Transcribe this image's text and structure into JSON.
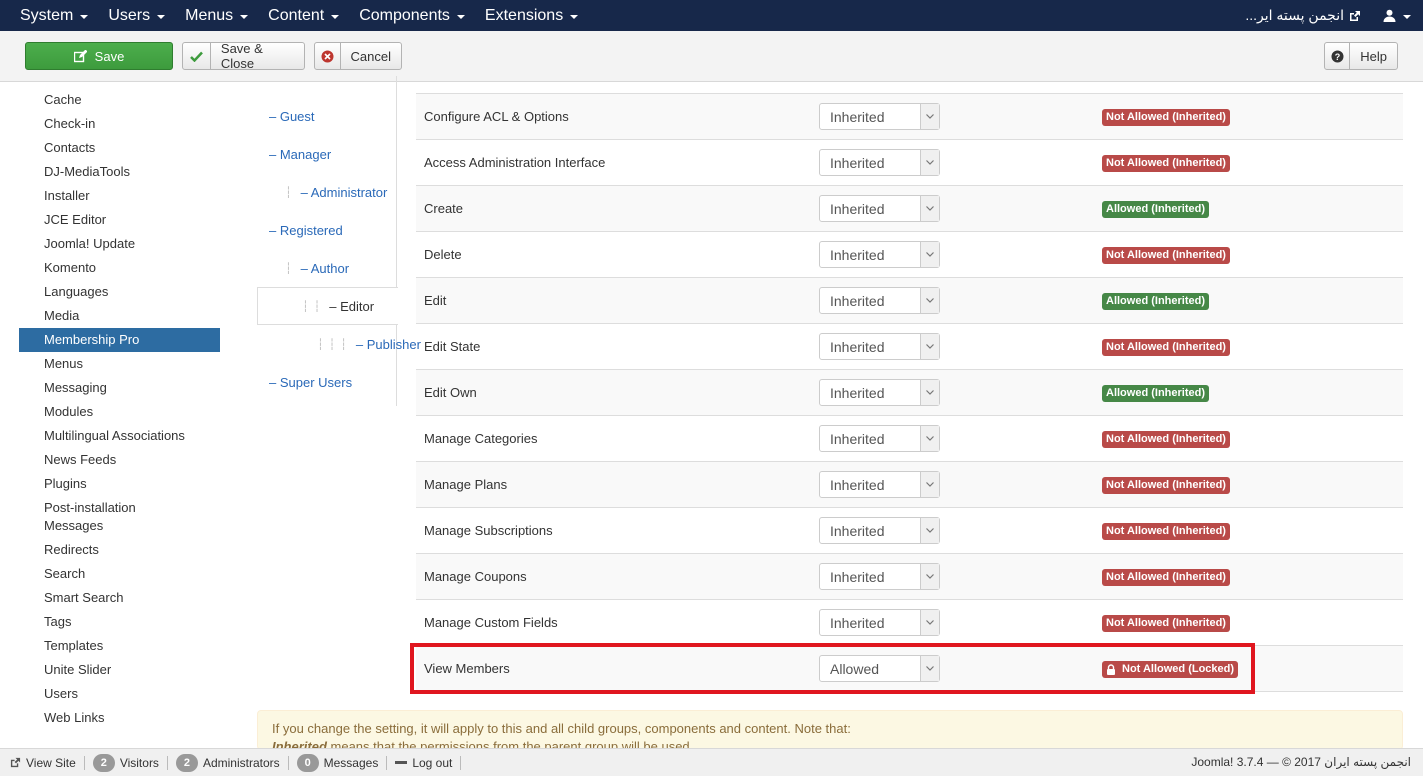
{
  "navbar": {
    "menu": [
      "System",
      "Users",
      "Menus",
      "Content",
      "Components",
      "Extensions"
    ],
    "site_name": "...انجمن پسته ایر"
  },
  "toolbar": {
    "save": "Save",
    "save_close": "Save & Close",
    "cancel": "Cancel",
    "help": "Help"
  },
  "sidebar": {
    "items": [
      "Cache",
      "Check-in",
      "Contacts",
      "DJ-MediaTools",
      "Installer",
      "JCE Editor",
      "Joomla! Update",
      "Komento",
      "Languages",
      "Media",
      "Membership Pro",
      "Menus",
      "Messaging",
      "Modules",
      "Multilingual Associations",
      "News Feeds",
      "Plugins",
      "Post-installation Messages",
      "Redirects",
      "Search",
      "Smart Search",
      "Tags",
      "Templates",
      "Unite Slider",
      "Users",
      "Web Links"
    ],
    "active": "Membership Pro"
  },
  "groups": [
    {
      "label": "– Guest",
      "depth": 0
    },
    {
      "label": "– Manager",
      "depth": 0
    },
    {
      "label": "– Administrator",
      "depth": 1
    },
    {
      "label": "– Registered",
      "depth": 0
    },
    {
      "label": "– Author",
      "depth": 1
    },
    {
      "label": "– Editor",
      "depth": 2
    },
    {
      "label": "– Publisher",
      "depth": 3
    },
    {
      "label": "– Super Users",
      "depth": 0
    }
  ],
  "active_group": "– Editor",
  "permissions": [
    {
      "action": "Configure ACL & Options",
      "setting": "Inherited",
      "calculated": "Not Allowed (Inherited)",
      "status": "denied"
    },
    {
      "action": "Access Administration Interface",
      "setting": "Inherited",
      "calculated": "Not Allowed (Inherited)",
      "status": "denied"
    },
    {
      "action": "Create",
      "setting": "Inherited",
      "calculated": "Allowed (Inherited)",
      "status": "allowed"
    },
    {
      "action": "Delete",
      "setting": "Inherited",
      "calculated": "Not Allowed (Inherited)",
      "status": "denied"
    },
    {
      "action": "Edit",
      "setting": "Inherited",
      "calculated": "Allowed (Inherited)",
      "status": "allowed"
    },
    {
      "action": "Edit State",
      "setting": "Inherited",
      "calculated": "Not Allowed (Inherited)",
      "status": "denied"
    },
    {
      "action": "Edit Own",
      "setting": "Inherited",
      "calculated": "Allowed (Inherited)",
      "status": "allowed"
    },
    {
      "action": "Manage Categories",
      "setting": "Inherited",
      "calculated": "Not Allowed (Inherited)",
      "status": "denied"
    },
    {
      "action": "Manage Plans",
      "setting": "Inherited",
      "calculated": "Not Allowed (Inherited)",
      "status": "denied"
    },
    {
      "action": "Manage Subscriptions",
      "setting": "Inherited",
      "calculated": "Not Allowed (Inherited)",
      "status": "denied"
    },
    {
      "action": "Manage Coupons",
      "setting": "Inherited",
      "calculated": "Not Allowed (Inherited)",
      "status": "denied"
    },
    {
      "action": "Manage Custom Fields",
      "setting": "Inherited",
      "calculated": "Not Allowed (Inherited)",
      "status": "denied"
    },
    {
      "action": "View Members",
      "setting": "Allowed",
      "calculated": "Not Allowed (Locked)",
      "status": "locked"
    }
  ],
  "note": {
    "line1": "If you change the setting, it will apply to this and all child groups, components and content. Note that:",
    "line2_em": "Inherited",
    "line2_rest": " means that the permissions from the parent group will be used."
  },
  "footer": {
    "view_site": "View Site",
    "visitors_count": "2",
    "visitors": "Visitors",
    "admins_count": "2",
    "admins": "Administrators",
    "messages_count": "0",
    "messages": "Messages",
    "logout": "Log out",
    "copyright": "Joomla! 3.7.4 — © 2017 انجمن پسته ایران"
  },
  "colors": {
    "navbar": "#17284a",
    "save_button": "#3d9b3d",
    "active_sidebar": "#2d6ca2",
    "badge_denied": "#b94a48",
    "badge_allowed": "#468847",
    "highlight": "#e0161f"
  }
}
